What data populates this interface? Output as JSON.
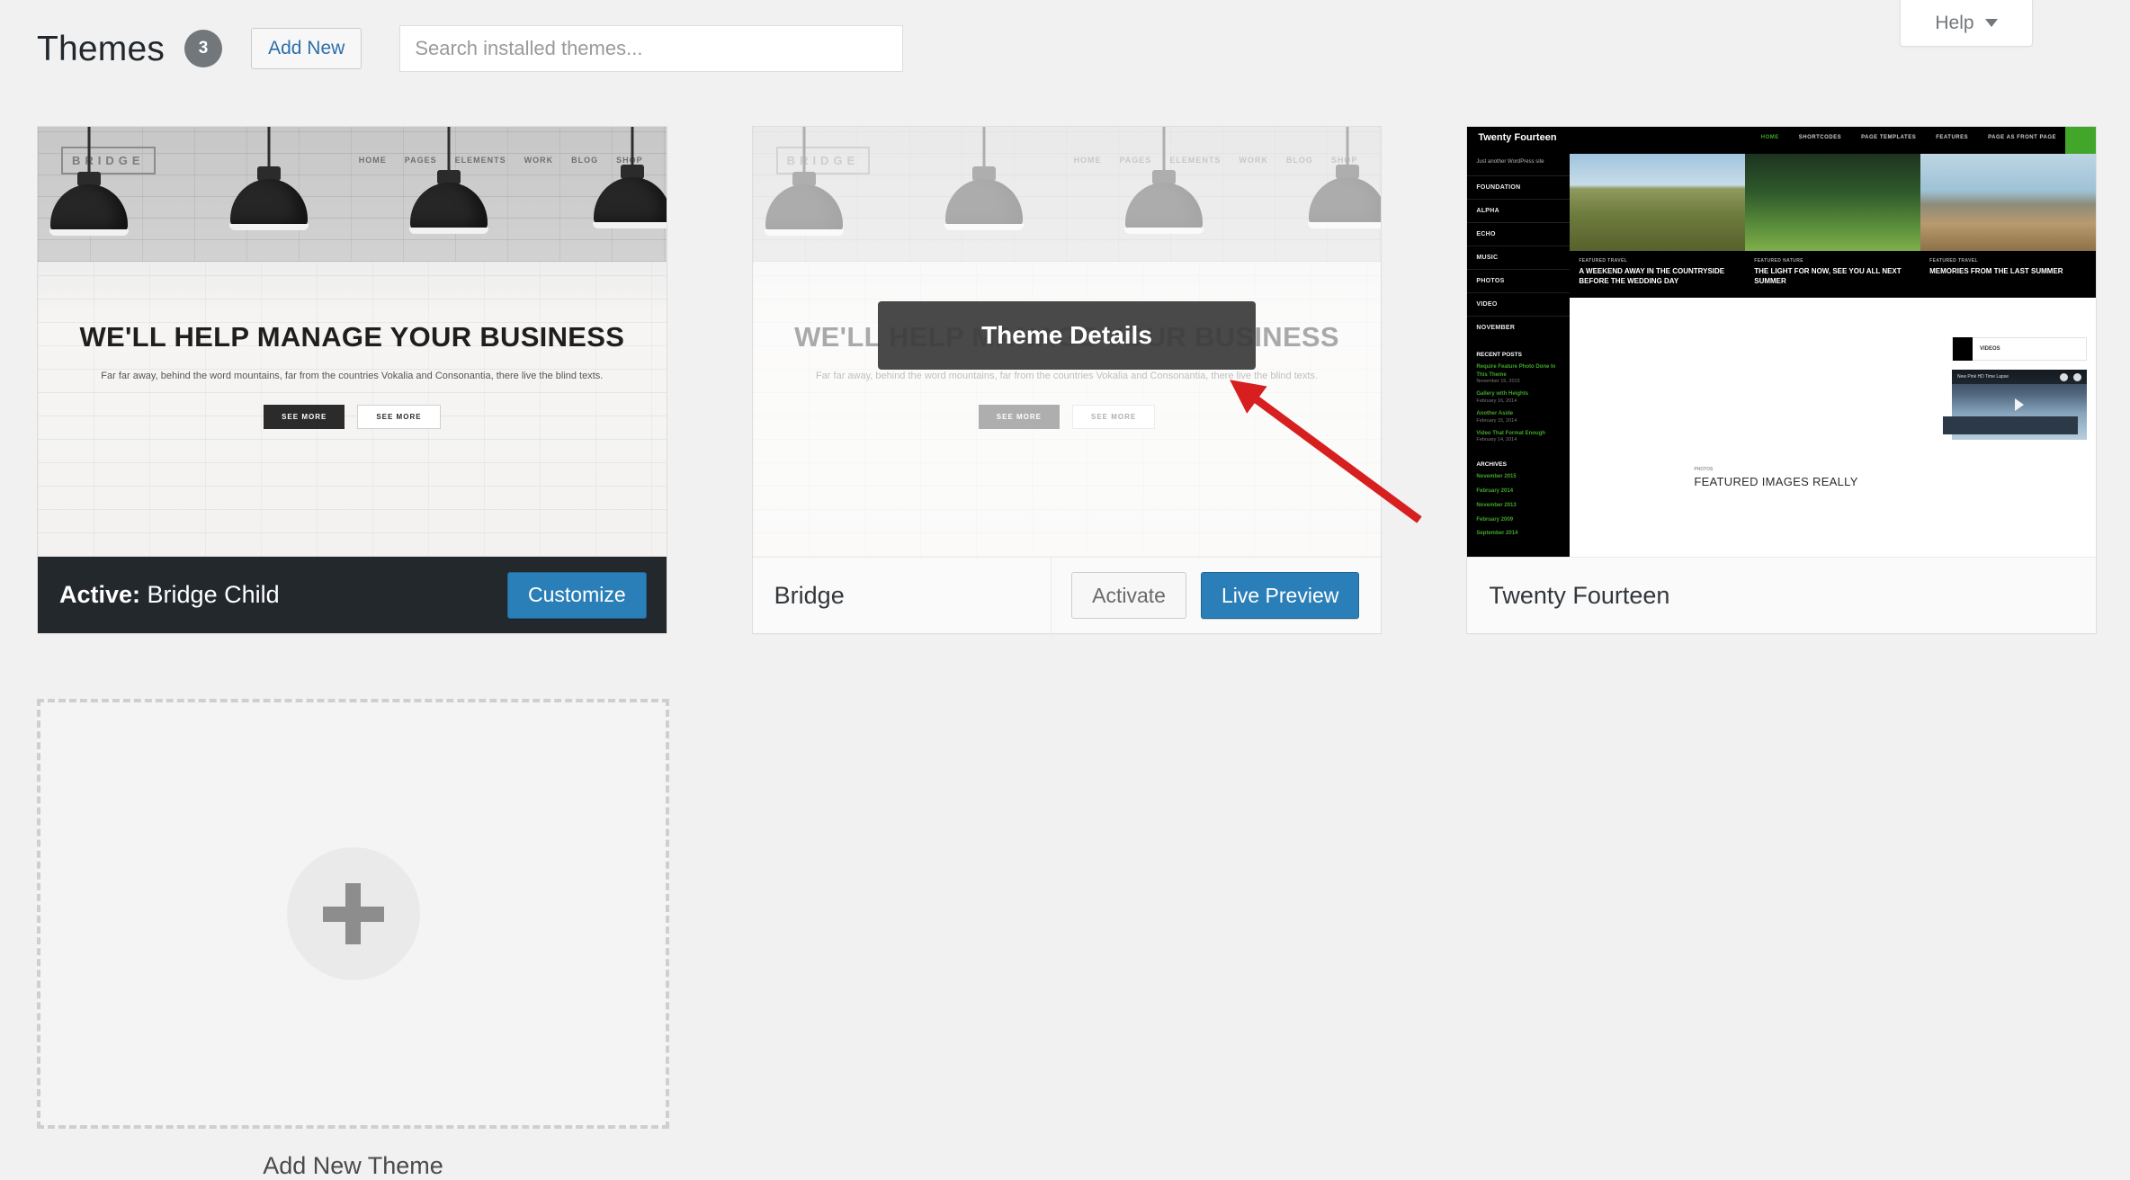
{
  "header": {
    "title": "Themes",
    "count": "3",
    "add_new_label": "Add New",
    "search_placeholder": "Search installed themes..."
  },
  "help_tab": {
    "label": "Help"
  },
  "themes": [
    {
      "name": "Bridge Child",
      "state_prefix": "Active:",
      "is_active": true,
      "primary_action": "Customize",
      "screenshot": {
        "kind": "bridge",
        "logo": "BRIDGE",
        "nav": [
          "HOME",
          "PAGES",
          "ELEMENTS",
          "WORK",
          "BLOG",
          "SHOP"
        ],
        "headline": "WE'LL HELP MANAGE YOUR BUSINESS",
        "subtext": "Far far away, behind the word mountains, far from the countries Vokalia and Consonantia, there live the blind texts.",
        "button_1": "SEE MORE",
        "button_2": "SEE MORE"
      }
    },
    {
      "name": "Bridge",
      "is_active": false,
      "hovered": true,
      "details_label": "Theme Details",
      "secondary_action": "Activate",
      "primary_action": "Live Preview",
      "screenshot": {
        "kind": "bridge",
        "logo": "BRIDGE",
        "nav": [
          "HOME",
          "PAGES",
          "ELEMENTS",
          "WORK",
          "BLOG",
          "SHOP"
        ],
        "headline": "WE'LL HELP MANAGE YOUR BUSINESS",
        "subtext": "Far far away, behind the word mountains, far from the countries Vokalia and Consonantia, there live the blind texts.",
        "button_1": "SEE MORE",
        "button_2": "SEE MORE"
      }
    },
    {
      "name": "Twenty Fourteen",
      "is_active": false,
      "screenshot": {
        "kind": "twentyfourteen",
        "brand": "Twenty Fourteen",
        "tagline": "Just another WordPress site",
        "menu": [
          "HOME",
          "SHORTCODES",
          "PAGE TEMPLATES",
          "FEATURES",
          "PAGE AS FRONT PAGE"
        ],
        "sidebar_nav": [
          "FOUNDATION",
          "ALPHA",
          "ECHO",
          "MUSIC",
          "PHOTOS",
          "VIDEO",
          "NOVEMBER"
        ],
        "recent_posts_title": "RECENT POSTS",
        "recent_posts": [
          {
            "title": "Require Feature Photo Done In This Theme",
            "date": "November 15, 2015"
          },
          {
            "title": "Gallery with Heights",
            "date": "February 16, 2014"
          },
          {
            "title": "Another Aside",
            "date": "February 15, 2014"
          },
          {
            "title": "Video That Format Enough",
            "date": "February 14, 2014"
          }
        ],
        "archives_title": "ARCHIVES",
        "archives": [
          "November 2015",
          "February 2014",
          "November 2013",
          "February 2009",
          "September 2014"
        ],
        "features": [
          {
            "kind": "FEATURED TRAVEL",
            "title": "A WEEKEND AWAY IN THE COUNTRYSIDE BEFORE THE WEDDING DAY"
          },
          {
            "kind": "FEATURED NATURE",
            "title": "THE LIGHT FOR NOW, SEE YOU ALL NEXT SUMMER"
          },
          {
            "kind": "FEATURED TRAVEL",
            "title": "MEMORIES FROM THE LAST SUMMER"
          }
        ],
        "hero_kind": "PHOTOS",
        "hero_title": "FEATURED IMAGES REALLY",
        "quote_label": "VIDEOS",
        "video_title": "New Pink HD Time Lapse"
      }
    }
  ],
  "add_theme": {
    "label": "Add New Theme"
  },
  "annotation": {
    "color": "#d81f1f"
  }
}
